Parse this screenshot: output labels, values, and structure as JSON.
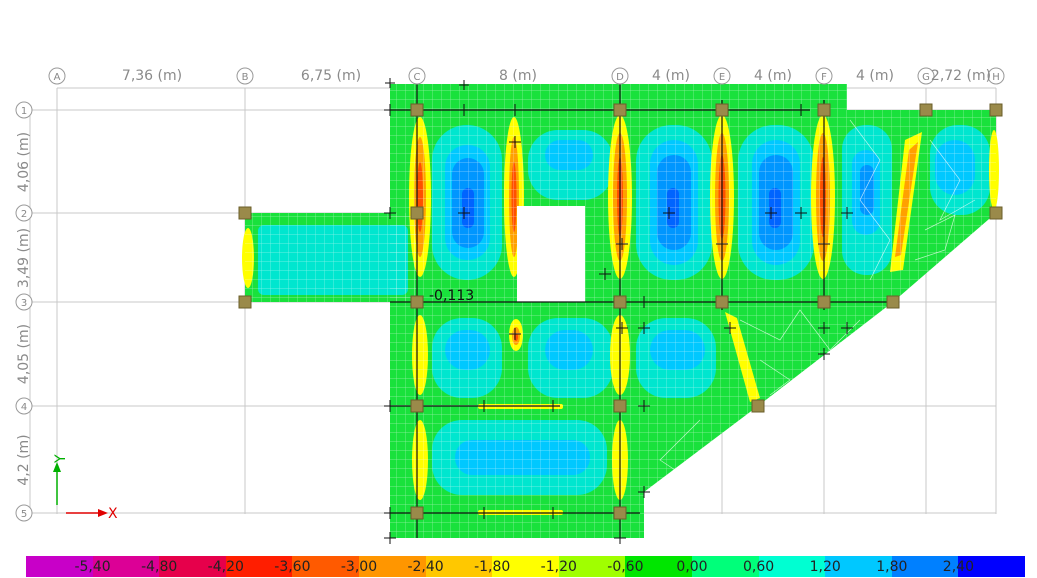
{
  "grid": {
    "columns": [
      "A",
      "B",
      "C",
      "D",
      "E",
      "F",
      "G",
      "H"
    ],
    "rows": [
      "1",
      "2",
      "3",
      "4",
      "5"
    ],
    "col_spacing_labels": [
      "7,36 (m)",
      "6,75 (m)",
      "8 (m)",
      "4 (m)",
      "4 (m)",
      "4 (m)",
      "2,72 (m)"
    ],
    "row_spacing_labels": [
      "4,06 (m)",
      "3,49 (m)",
      "4,05 (m)",
      "4,2 (m)"
    ]
  },
  "annotation": {
    "value_label": "-0,113"
  },
  "axes": {
    "y_label": "Y",
    "x_label": "X"
  },
  "legend": {
    "labels": [
      "-5,40",
      "-4,80",
      "-4,20",
      "-3,60",
      "-3,00",
      "-2,40",
      "-1,80",
      "-1,20",
      "-0,60",
      "0,00",
      "0,60",
      "1,20",
      "1,80",
      "2,40"
    ],
    "colors": [
      "#c800c8",
      "#dc0096",
      "#e6004b",
      "#ff1e00",
      "#ff5a00",
      "#ff9600",
      "#ffc800",
      "#ffff00",
      "#a0ff00",
      "#00e600",
      "#00ff7a",
      "#00ffd2",
      "#00c8ff",
      "#0080ff",
      "#0000ff"
    ]
  }
}
